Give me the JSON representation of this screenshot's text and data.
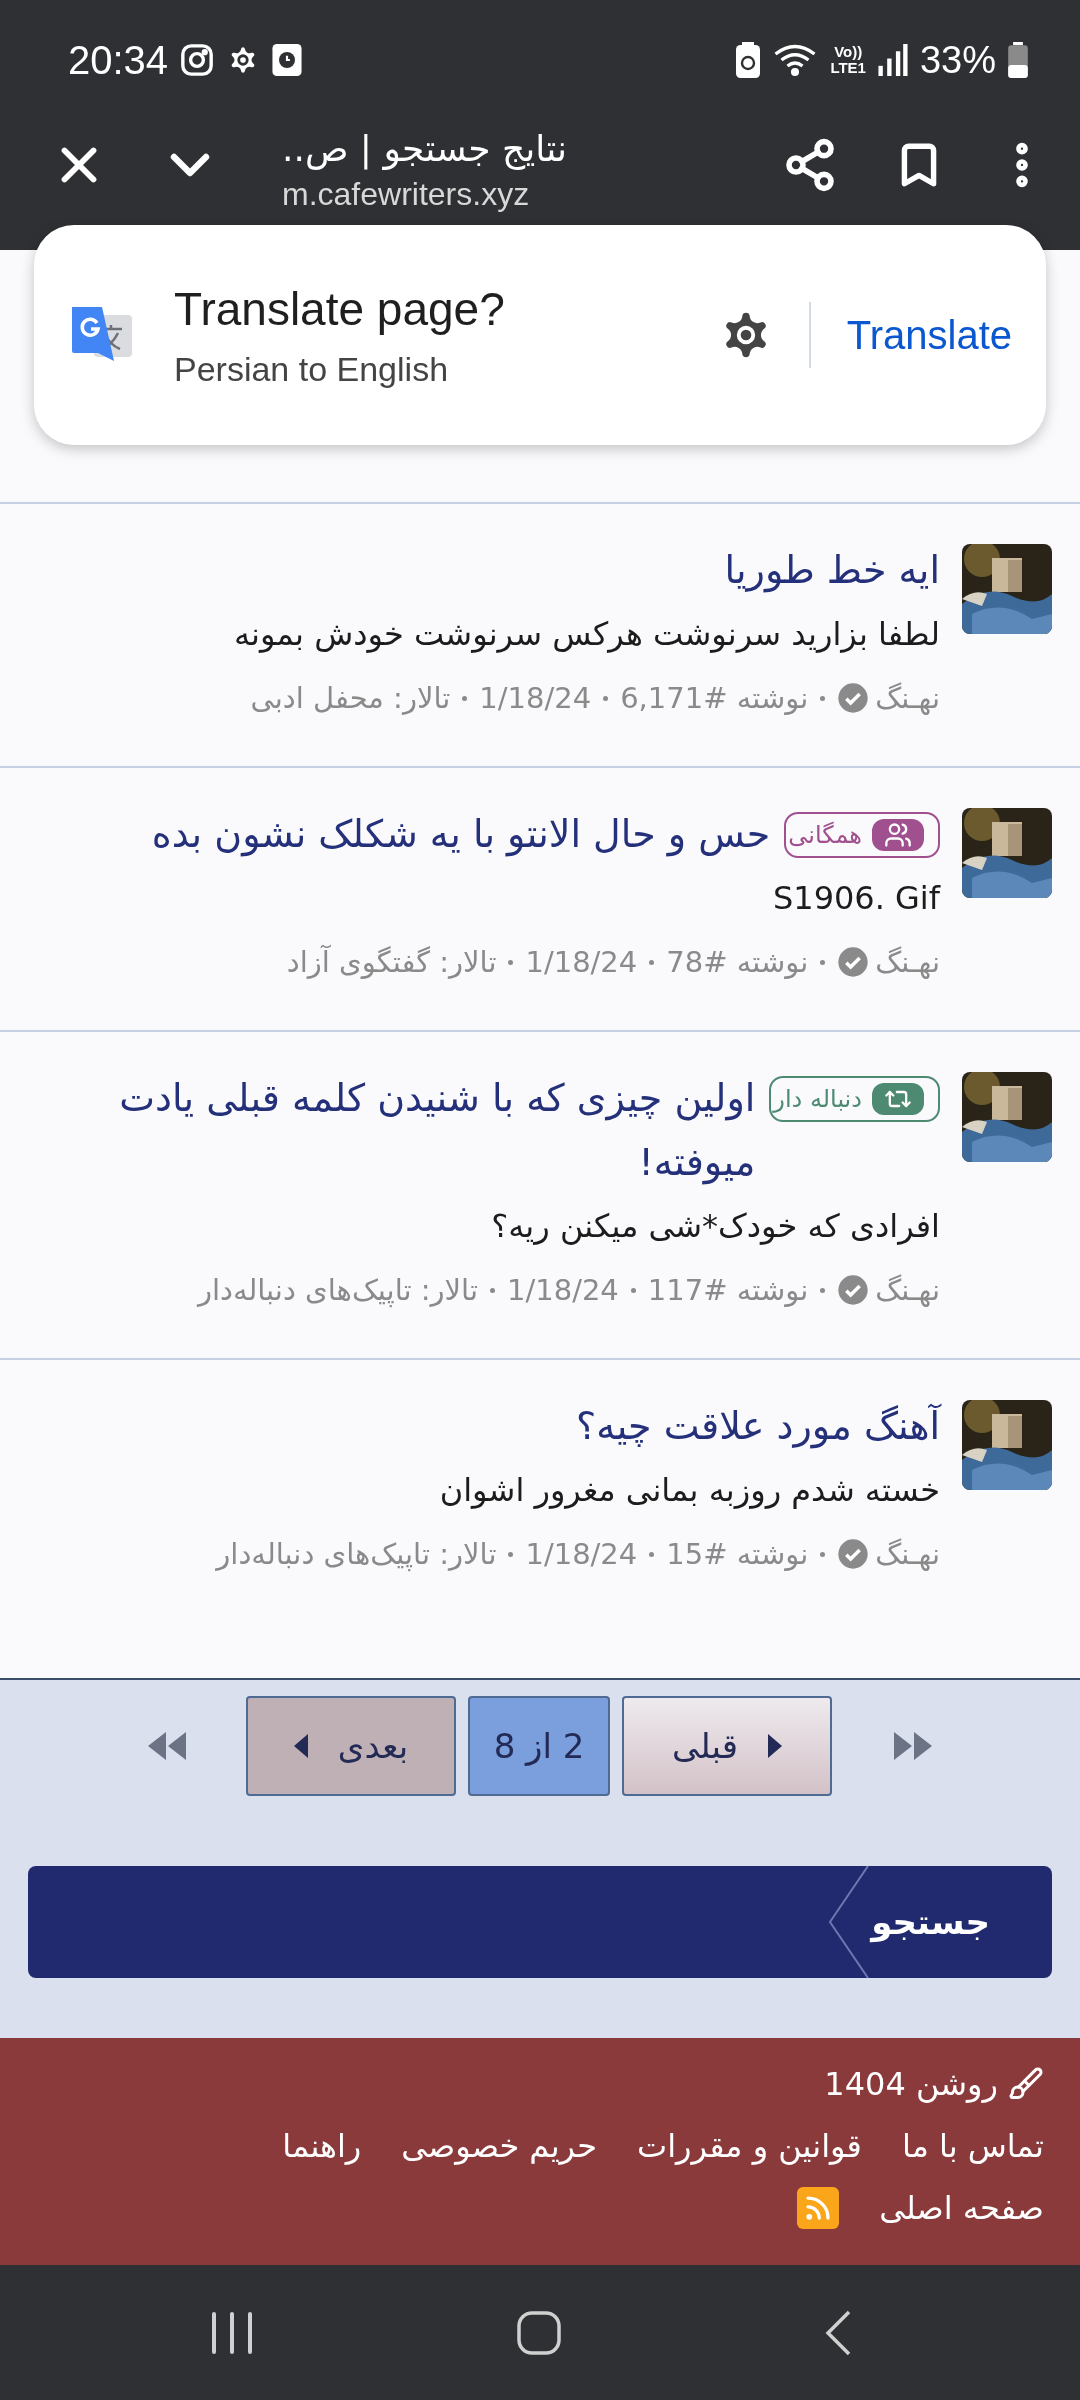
{
  "status_bar": {
    "time": "20:34",
    "volte": "Vo))",
    "network": "LTE1",
    "battery": "33%"
  },
  "toolbar": {
    "title": "نتایج جستجو | ص..",
    "url": "m.cafewriters.xyz"
  },
  "translate_prompt": {
    "title": "Translate page?",
    "subtitle": "Persian to English",
    "action": "Translate"
  },
  "results": [
    {
      "title": "ایه خط طوریا",
      "snippet": "لطفا بزارید سرنوشت هرکس سرنوشت خودش بمونه",
      "author": "نهـنگ",
      "post": "نوشته #6,171",
      "date": "1/18/24",
      "forum": "تالار: محفل ادبی"
    },
    {
      "badge": {
        "label": "همگانی",
        "kind": "public",
        "color": "#a0508f"
      },
      "title": "حس و حال الانتو با یه شکلک نشون بده",
      "snippet": "S1906. Gif",
      "author": "نهـنگ",
      "post": "نوشته #78",
      "date": "1/18/24",
      "forum": "تالار: گفتگوی آزاد"
    },
    {
      "badge": {
        "label": "دنباله دار",
        "kind": "thread",
        "color": "#4e8a72"
      },
      "title": "اولین چیزی که با شنیدن کلمه قبلی یادت میوفته!",
      "snippet": "افرادی که خودک*شی میکنن ریه؟",
      "author": "نهـنگ",
      "post": "نوشته #117",
      "date": "1/18/24",
      "forum": "تالار: تاپیک‌های دنباله‌دار"
    },
    {
      "title": "آهنگ مورد علاقت چیه؟",
      "snippet": "خسته شدم روزبه بمانی مغرور اشوان",
      "author": "نهـنگ",
      "post": "نوشته #15",
      "date": "1/18/24",
      "forum": "تالار: تاپیک‌های دنباله‌دار"
    }
  ],
  "pagination": [
    {
      "label": "قبلی",
      "kind": "prev"
    },
    {
      "label": "2 از 8",
      "kind": "current"
    },
    {
      "label": "بعدی",
      "kind": "next"
    }
  ],
  "search_bar": {
    "label": "جستجو"
  },
  "footer": {
    "style": "روشن 1404",
    "links": [
      "تماس با ما",
      "قوانین و مقررات",
      "حریم خصوصی",
      "راهنما"
    ],
    "home": "صفحه اصلی"
  }
}
